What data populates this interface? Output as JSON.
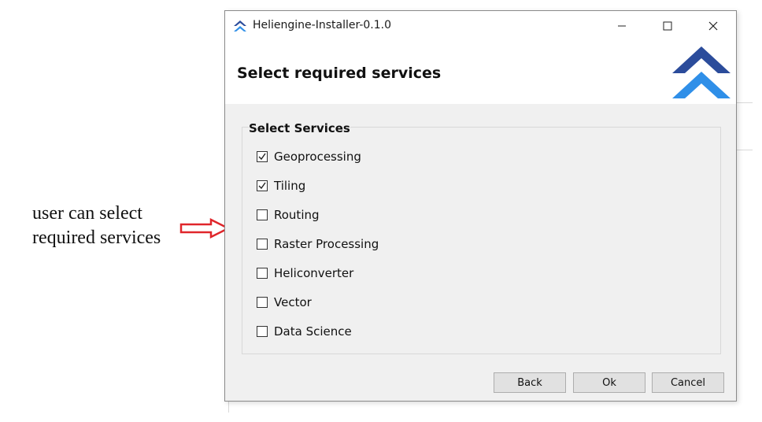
{
  "annotation": {
    "line1": "user can select",
    "line2": "required services"
  },
  "window": {
    "title": "Heliengine-Installer-0.1.0",
    "minimize": "—",
    "maximize": "☐",
    "close": "✕"
  },
  "header": {
    "title": "Select required services"
  },
  "services": {
    "group_title": "Select Services",
    "items": [
      {
        "label": "Geoprocessing",
        "checked": true
      },
      {
        "label": "Tiling",
        "checked": true
      },
      {
        "label": "Routing",
        "checked": false
      },
      {
        "label": "Raster Processing",
        "checked": false
      },
      {
        "label": "Heliconverter",
        "checked": false
      },
      {
        "label": "Vector",
        "checked": false
      },
      {
        "label": "Data Science",
        "checked": false
      }
    ]
  },
  "buttons": {
    "back": "Back",
    "ok": "Ok",
    "cancel": "Cancel"
  },
  "colors": {
    "logo_dark": "#2b4c9b",
    "logo_light": "#2f8fe8",
    "arrow": "#e0262b"
  }
}
